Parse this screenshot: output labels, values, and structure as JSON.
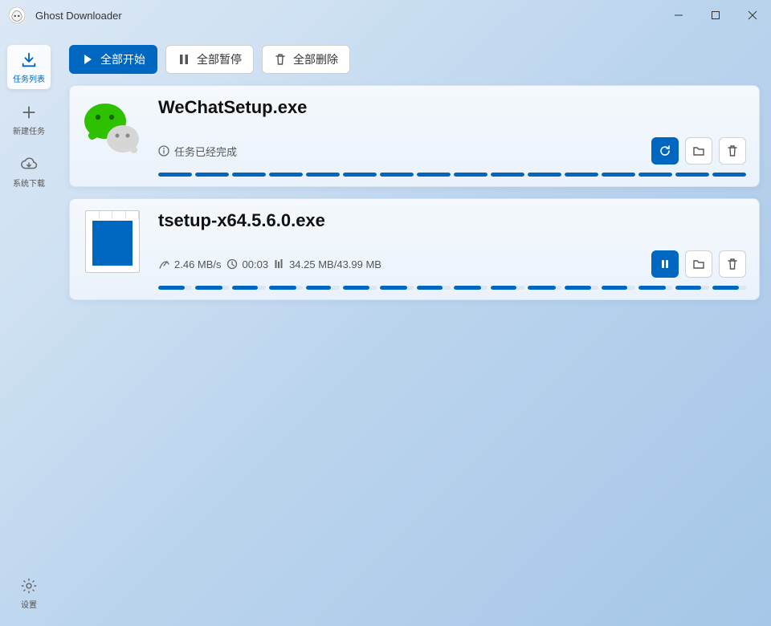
{
  "title_bar": {
    "title": "Ghost Downloader"
  },
  "sidebar": {
    "items": [
      {
        "label": "任务列表"
      },
      {
        "label": "新建任务"
      },
      {
        "label": "系统下载"
      }
    ],
    "settings_label": "设置"
  },
  "toolbar": {
    "start_all": "全部开始",
    "pause_all": "全部暂停",
    "delete_all": "全部删除"
  },
  "tasks": [
    {
      "name": "WeChatSetup.exe",
      "status_text": "任务已经完成",
      "segments": [
        1,
        1,
        1,
        1,
        1,
        1,
        1,
        1,
        1,
        1,
        1,
        1,
        1,
        1,
        1,
        1
      ]
    },
    {
      "name": "tsetup-x64.5.6.0.exe",
      "speed": "2.46 MB/s",
      "eta": "00:03",
      "progress": "34.25 MB/43.99 MB",
      "segments": [
        0.78,
        0.8,
        0.76,
        0.82,
        0.74,
        0.79,
        0.81,
        0.77,
        0.8,
        0.75,
        0.83,
        0.78,
        0.76,
        0.8,
        0.77,
        0.79
      ]
    }
  ]
}
